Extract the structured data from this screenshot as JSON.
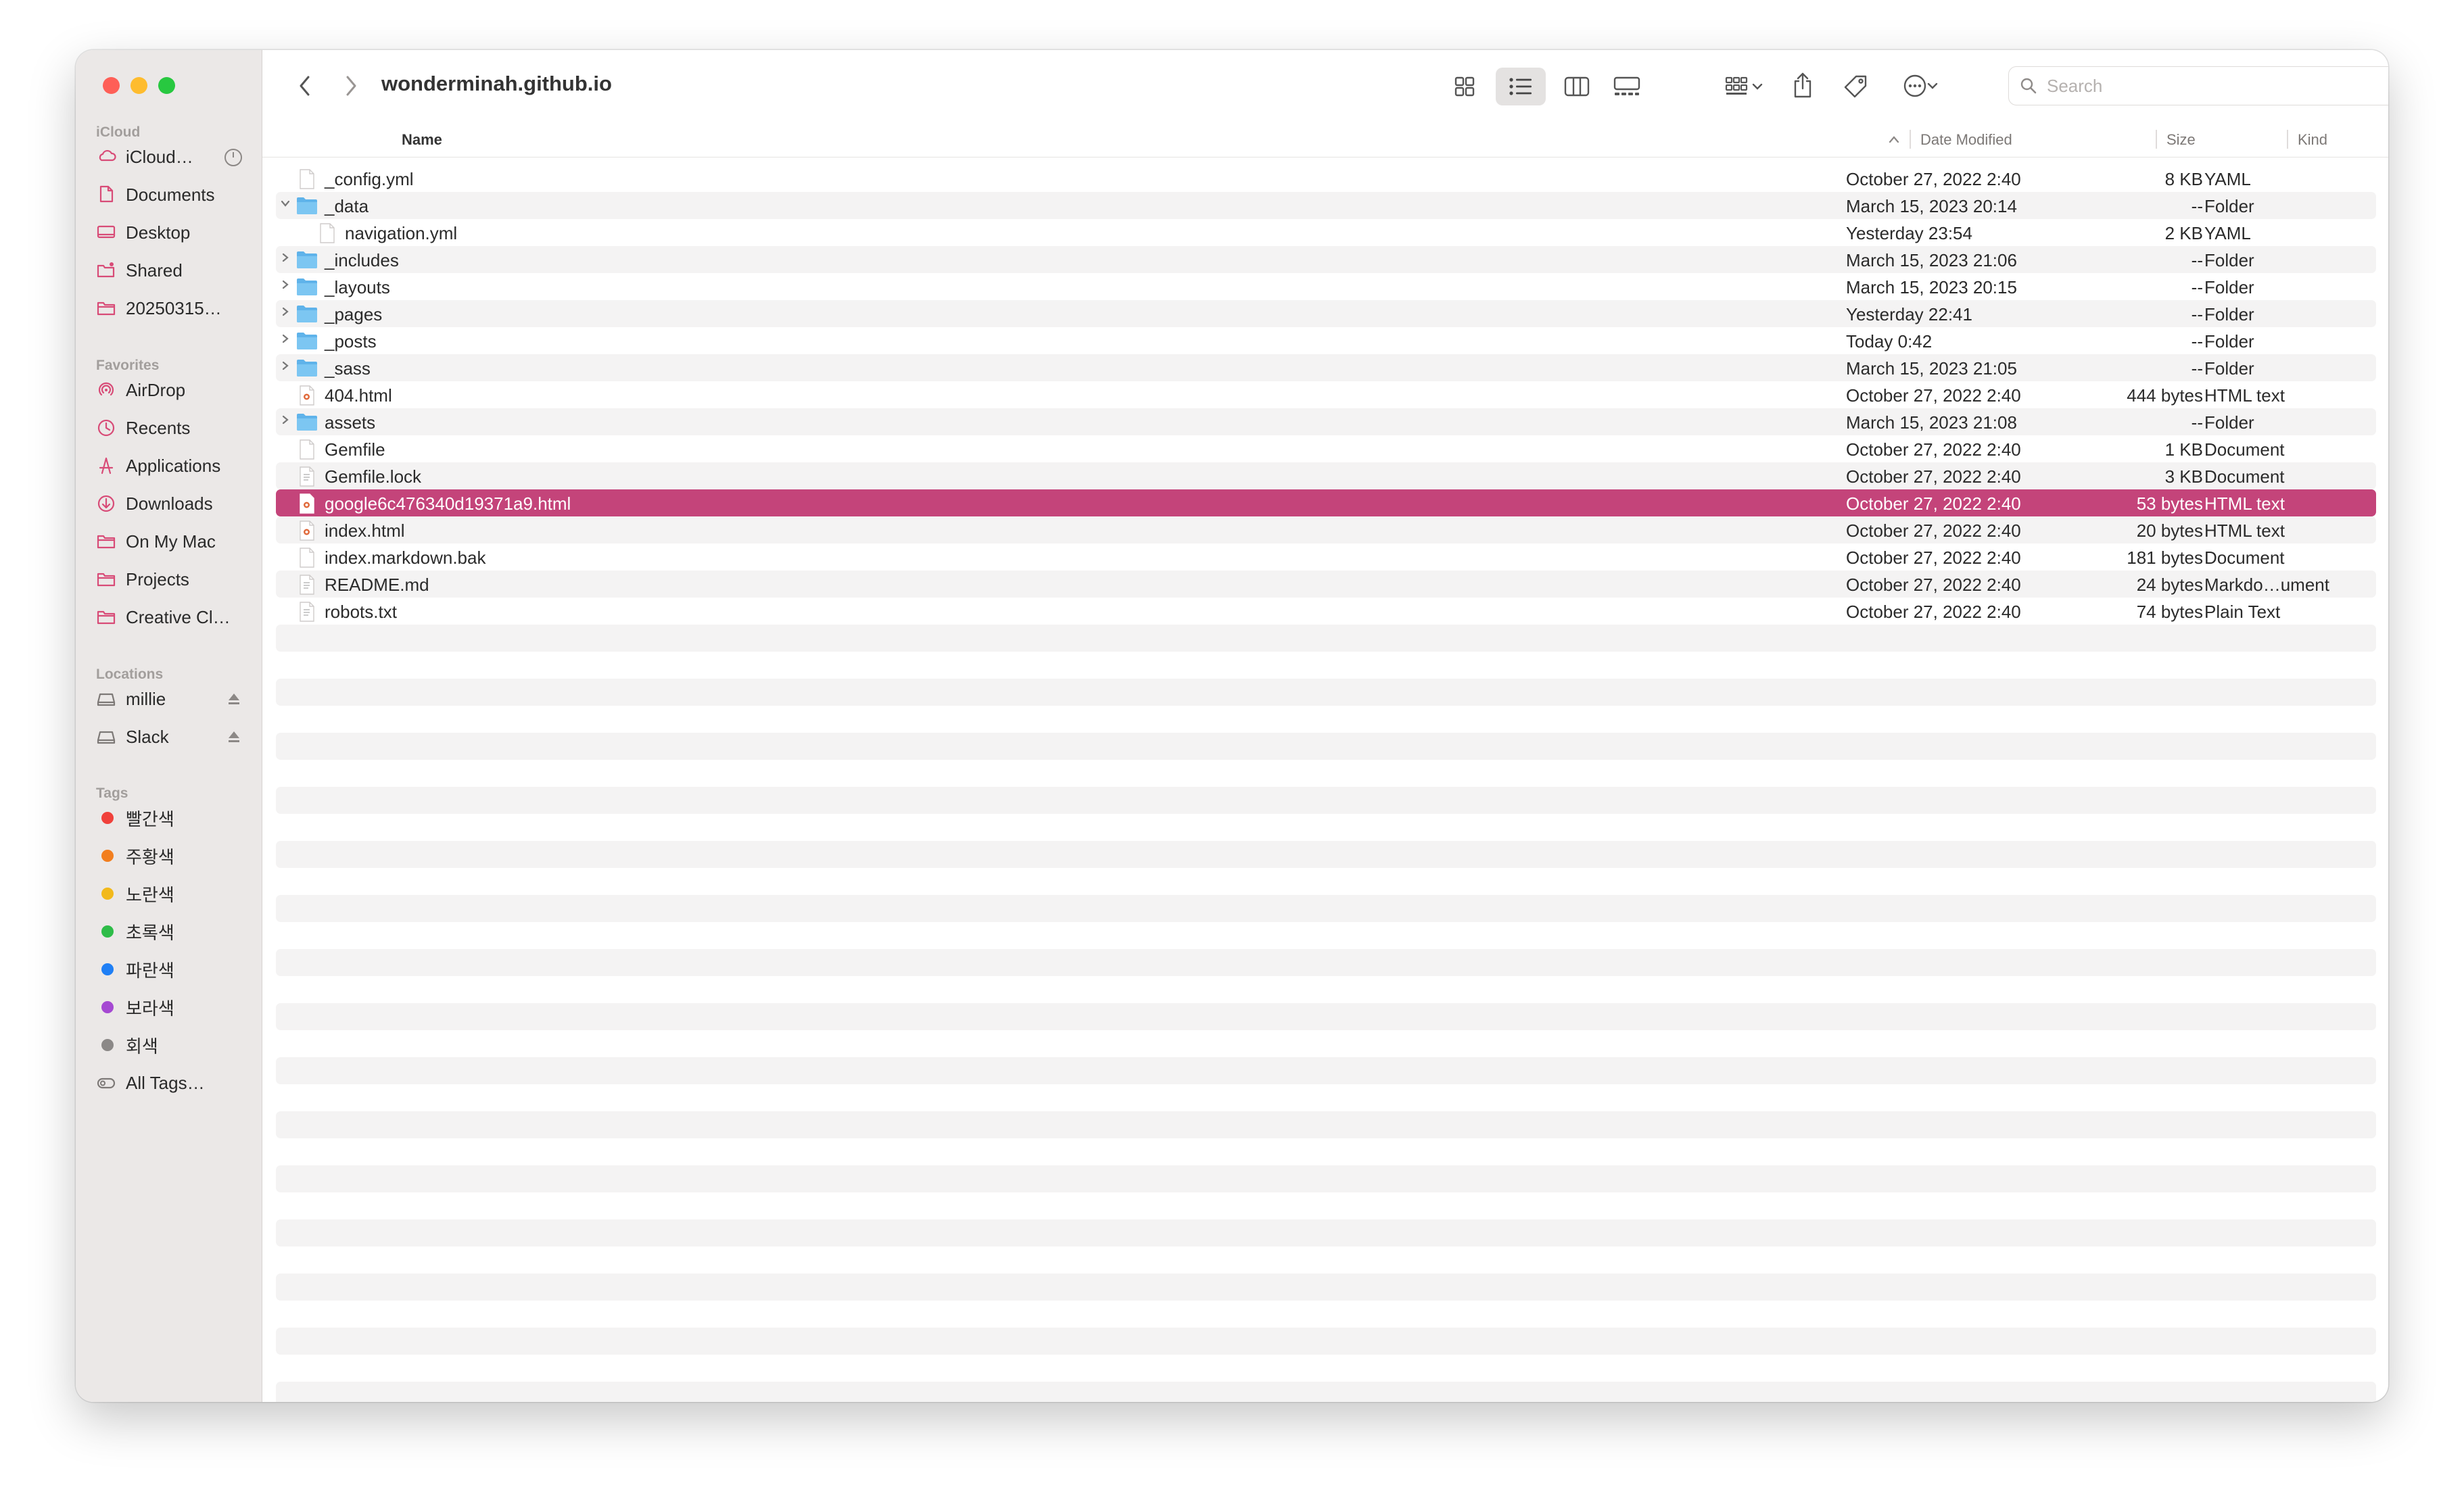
{
  "window": {
    "title": "wonderminah.github.io"
  },
  "sidebar": {
    "sections": [
      {
        "title": "iCloud",
        "items": [
          {
            "label": "iCloud…",
            "icon": "cloud-icon"
          },
          {
            "label": "Documents",
            "icon": "document-icon"
          },
          {
            "label": "Desktop",
            "icon": "desktop-icon"
          },
          {
            "label": "Shared",
            "icon": "shared-folder-icon"
          },
          {
            "label": "20250315…",
            "icon": "folder-icon"
          }
        ]
      },
      {
        "title": "Favorites",
        "items": [
          {
            "label": "AirDrop",
            "icon": "airdrop-icon"
          },
          {
            "label": "Recents",
            "icon": "clock-icon"
          },
          {
            "label": "Applications",
            "icon": "applications-icon"
          },
          {
            "label": "Downloads",
            "icon": "download-icon"
          },
          {
            "label": "On My Mac",
            "icon": "folder-icon"
          },
          {
            "label": "Projects",
            "icon": "folder-icon"
          },
          {
            "label": "Creative Cl…",
            "icon": "folder-icon"
          }
        ]
      },
      {
        "title": "Locations",
        "items": [
          {
            "label": "millie",
            "icon": "drive-icon"
          },
          {
            "label": "Slack",
            "icon": "drive-icon"
          }
        ]
      },
      {
        "title": "Tags",
        "items": [
          {
            "label": "빨간색",
            "color": "#f0413b"
          },
          {
            "label": "주황색",
            "color": "#f27e1e"
          },
          {
            "label": "노란색",
            "color": "#f2b91b"
          },
          {
            "label": "초록색",
            "color": "#2ebc48"
          },
          {
            "label": "파란색",
            "color": "#1f7ff5"
          },
          {
            "label": "보라색",
            "color": "#a549d2"
          },
          {
            "label": "회색",
            "color": "#8b8887"
          },
          {
            "label": "All Tags…",
            "icon": "all-tags-icon"
          }
        ]
      }
    ]
  },
  "toolbar": {
    "back_icon": "chevron-left-icon",
    "forward_icon": "chevron-right-icon",
    "view_icons": [
      "icon-view-icon",
      "list-view-icon",
      "column-view-icon",
      "gallery-view-icon"
    ],
    "group_icon": "group-by-icon",
    "share_icon": "share-icon",
    "tag_icon": "tag-icon",
    "more_icon": "more-actions-icon",
    "search_placeholder": "Search"
  },
  "list": {
    "columns": {
      "name": "Name",
      "date": "Date Modified",
      "size": "Size",
      "kind": "Kind"
    },
    "selected_color": "#c4447a",
    "rows": [
      {
        "name": "_config.yml",
        "date": "October 27, 2022 2:40",
        "size": "8 KB",
        "kind": "YAML",
        "icon": "file-icon"
      },
      {
        "name": "_data",
        "date": "March 15, 2023 20:14",
        "size": "--",
        "kind": "Folder",
        "icon": "folder-icon",
        "expanded": true
      },
      {
        "name": "navigation.yml",
        "date": "Yesterday 23:54",
        "size": "2 KB",
        "kind": "YAML",
        "icon": "file-icon",
        "indent": 1
      },
      {
        "name": "_includes",
        "date": "March 15, 2023 21:06",
        "size": "--",
        "kind": "Folder",
        "icon": "folder-icon",
        "collapsed": true
      },
      {
        "name": "_layouts",
        "date": "March 15, 2023 20:15",
        "size": "--",
        "kind": "Folder",
        "icon": "folder-icon",
        "collapsed": true
      },
      {
        "name": "_pages",
        "date": "Yesterday 22:41",
        "size": "--",
        "kind": "Folder",
        "icon": "folder-icon",
        "collapsed": true
      },
      {
        "name": "_posts",
        "date": "Today 0:42",
        "size": "--",
        "kind": "Folder",
        "icon": "folder-icon",
        "collapsed": true
      },
      {
        "name": "_sass",
        "date": "March 15, 2023 21:05",
        "size": "--",
        "kind": "Folder",
        "icon": "folder-icon",
        "collapsed": true
      },
      {
        "name": "404.html",
        "date": "October 27, 2022 2:40",
        "size": "444 bytes",
        "kind": "HTML text",
        "icon": "html-file-icon"
      },
      {
        "name": "assets",
        "date": "March 15, 2023 21:08",
        "size": "--",
        "kind": "Folder",
        "icon": "folder-icon",
        "collapsed": true
      },
      {
        "name": "Gemfile",
        "date": "October 27, 2022 2:40",
        "size": "1 KB",
        "kind": "Document",
        "icon": "file-icon"
      },
      {
        "name": "Gemfile.lock",
        "date": "October 27, 2022 2:40",
        "size": "3 KB",
        "kind": "Document",
        "icon": "text-file-icon"
      },
      {
        "name": "google6c476340d19371a9.html",
        "date": "October 27, 2022 2:40",
        "size": "53 bytes",
        "kind": "HTML text",
        "icon": "html-file-icon",
        "selected": true
      },
      {
        "name": "index.html",
        "date": "October 27, 2022 2:40",
        "size": "20 bytes",
        "kind": "HTML text",
        "icon": "html-file-icon"
      },
      {
        "name": "index.markdown.bak",
        "date": "October 27, 2022 2:40",
        "size": "181 bytes",
        "kind": "Document",
        "icon": "file-icon"
      },
      {
        "name": "README.md",
        "date": "October 27, 2022 2:40",
        "size": "24 bytes",
        "kind": "Markdo…ument",
        "icon": "text-file-icon"
      },
      {
        "name": "robots.txt",
        "date": "October 27, 2022 2:40",
        "size": "74 bytes",
        "kind": "Plain Text",
        "icon": "text-file-icon"
      }
    ]
  }
}
